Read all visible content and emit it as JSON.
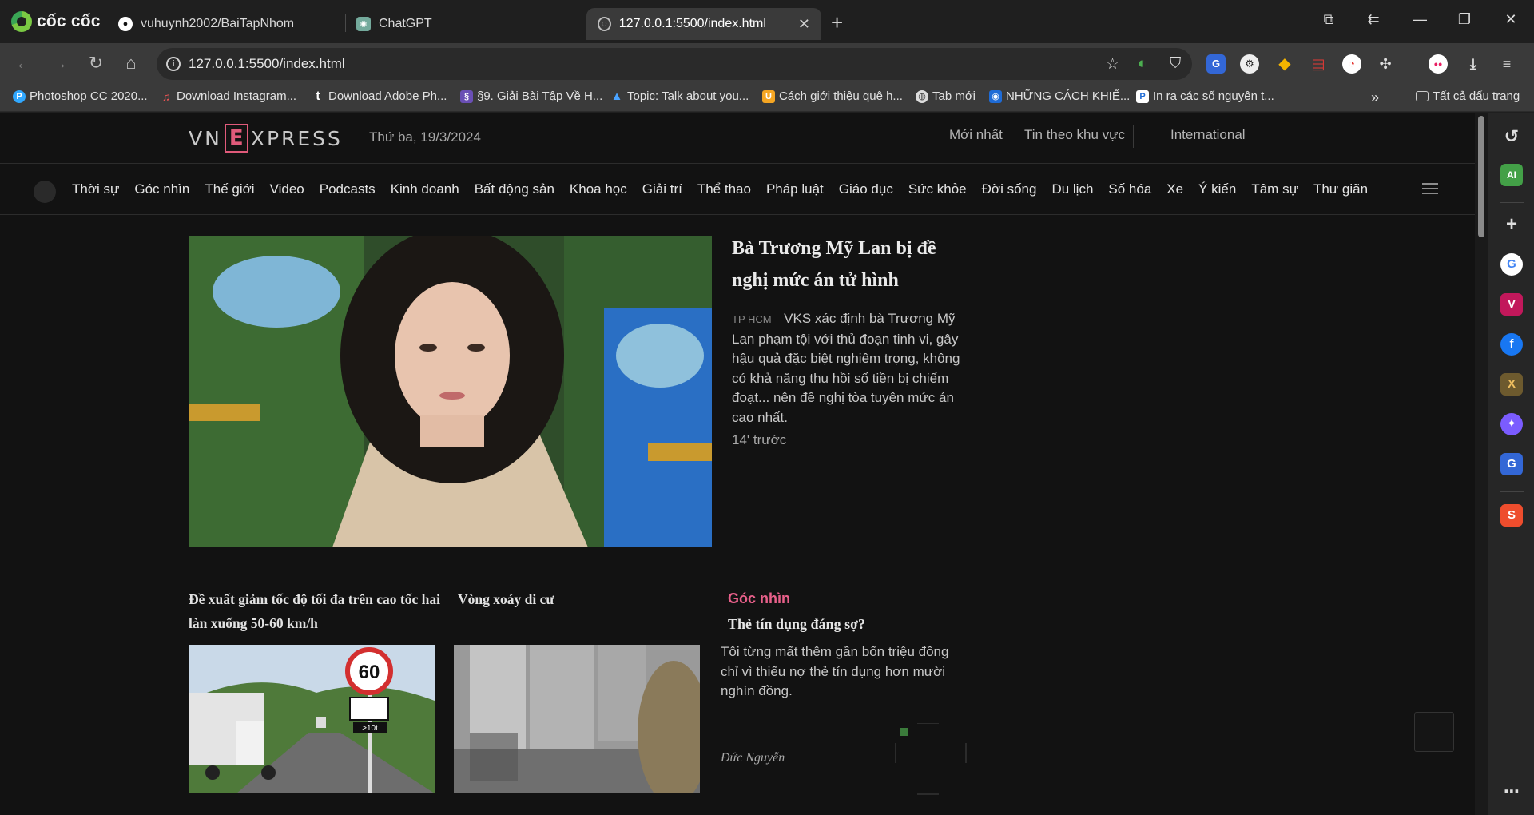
{
  "browser": {
    "brand": "cốc cốc",
    "tabs": [
      {
        "title": "vuhuynh2002/BaiTapNhom"
      },
      {
        "title": "ChatGPT"
      },
      {
        "title": "127.0.0.1:5500/index.html"
      }
    ],
    "url": "127.0.0.1:5500/index.html",
    "bookmarks": [
      "Photoshop CC 2020...",
      "Download Instagram...",
      "Download Adobe Ph...",
      "§9. Giải Bài Tập Về H...",
      "Topic: Talk about you...",
      "Cách giới thiệu quê h...",
      "Tab mới",
      "NHỮNG CÁCH KHIẾ...",
      "In ra các số nguyên t..."
    ],
    "all_bookmarks": "Tất cả dấu trang",
    "sidebar_ai": "AI"
  },
  "site": {
    "logo_left": "VN",
    "logo_e": "E",
    "logo_right": "XPRESS",
    "date": "Thứ ba, 19/3/2024",
    "top_links": [
      "Mới nhất",
      "Tin theo khu vực",
      "International"
    ],
    "nav": [
      "Thời sự",
      "Góc nhìn",
      "Thế giới",
      "Video",
      "Podcasts",
      "Kinh doanh",
      "Bất động sản",
      "Khoa học",
      "Giải trí",
      "Thể thao",
      "Pháp luật",
      "Giáo dục",
      "Sức khỏe",
      "Đời sống",
      "Du lịch",
      "Số hóa",
      "Xe",
      "Ý kiến",
      "Tâm sự",
      "Thư giãn"
    ]
  },
  "hero": {
    "title": "Bà Trương Mỹ Lan bị đề nghị mức án tử hình",
    "location": "TP HCM –",
    "description": "VKS xác định bà Trương Mỹ Lan phạm tội với thủ đoạn tinh vi, gây hậu quả đặc biệt nghiêm trọng, không có khả năng thu hồi số tiền bị chiếm đoạt... nên đề nghị tòa tuyên mức án cao nhất.",
    "time": "14' trước"
  },
  "cards": [
    {
      "title": "Đề xuất giảm tốc độ tối đa trên cao tốc hai làn xuống 50-60 km/h",
      "sign_speed": "60",
      "sign_sub": ">10t"
    },
    {
      "title": "Vòng xoáy di cư"
    }
  ],
  "goc_nhin": {
    "label": "Góc nhìn",
    "title": "Thẻ tín dụng đáng sợ?",
    "description": "Tôi từng mất thêm gần bốn triệu đồng chỉ vì thiếu nợ thẻ tín dụng hơn mười nghìn đồng.",
    "author": "Đức Nguyễn"
  },
  "colors": {
    "accent": "#e8608a",
    "bg": "#121212",
    "chrome": "#3a3a3a"
  }
}
